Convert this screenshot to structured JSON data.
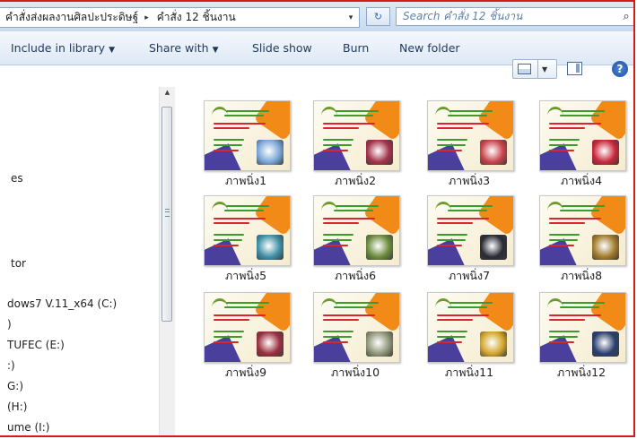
{
  "address": {
    "crumbs": [
      "คำสั่งส่งผลงานศิลปะประดิษฐ์",
      "คำสั่ง 12 ชิ้นงาน"
    ],
    "separator": "▸",
    "dropdown": "▾",
    "refresh": "↻"
  },
  "search": {
    "placeholder": "Search คำสั่ง 12 ชิ้นงาน",
    "icon": "search-icon"
  },
  "toolbar": {
    "include_label": "Include in library",
    "share_label": "Share with",
    "slideshow_label": "Slide show",
    "burn_label": "Burn",
    "newfolder_label": "New folder",
    "dropdown_arrow": "▼",
    "help_label": "?"
  },
  "nav": {
    "items": [
      "es",
      "tor",
      "dows7 V.11_x64 (C:)",
      ")",
      "TUFEC (E:)",
      ":)",
      "G:)",
      "(H:)",
      "ume (I:)"
    ]
  },
  "scrollbar": {
    "up_arrow": "▲"
  },
  "files": [
    {
      "name": "ภาพนิ่ง1",
      "photo": "#7aa7d8"
    },
    {
      "name": "ภาพนิ่ง2",
      "photo": "#a3324a"
    },
    {
      "name": "ภาพนิ่ง3",
      "photo": "#c7434a"
    },
    {
      "name": "ภาพนิ่ง4",
      "photo": "#c9273a"
    },
    {
      "name": "ภาพนิ่ง5",
      "photo": "#3f8fa6"
    },
    {
      "name": "ภาพนิ่ง6",
      "photo": "#6b8a3d"
    },
    {
      "name": "ภาพนิ่ง7",
      "photo": "#2a2a36"
    },
    {
      "name": "ภาพนิ่ง8",
      "photo": "#a17b2b"
    },
    {
      "name": "ภาพนิ่ง9",
      "photo": "#9b2f3f"
    },
    {
      "name": "ภาพนิ่ง10",
      "photo": "#8f9678"
    },
    {
      "name": "ภาพนิ่ง11",
      "photo": "#d3a62b"
    },
    {
      "name": "ภาพนิ่ง12",
      "photo": "#2b3f6e"
    }
  ],
  "colors": {
    "frame_border": "#d21c1c",
    "thumb_green": "#3c9a2f",
    "thumb_red": "#d8262e",
    "thumb_orange": "#f28a18",
    "thumb_purple": "#4b3f9e"
  }
}
